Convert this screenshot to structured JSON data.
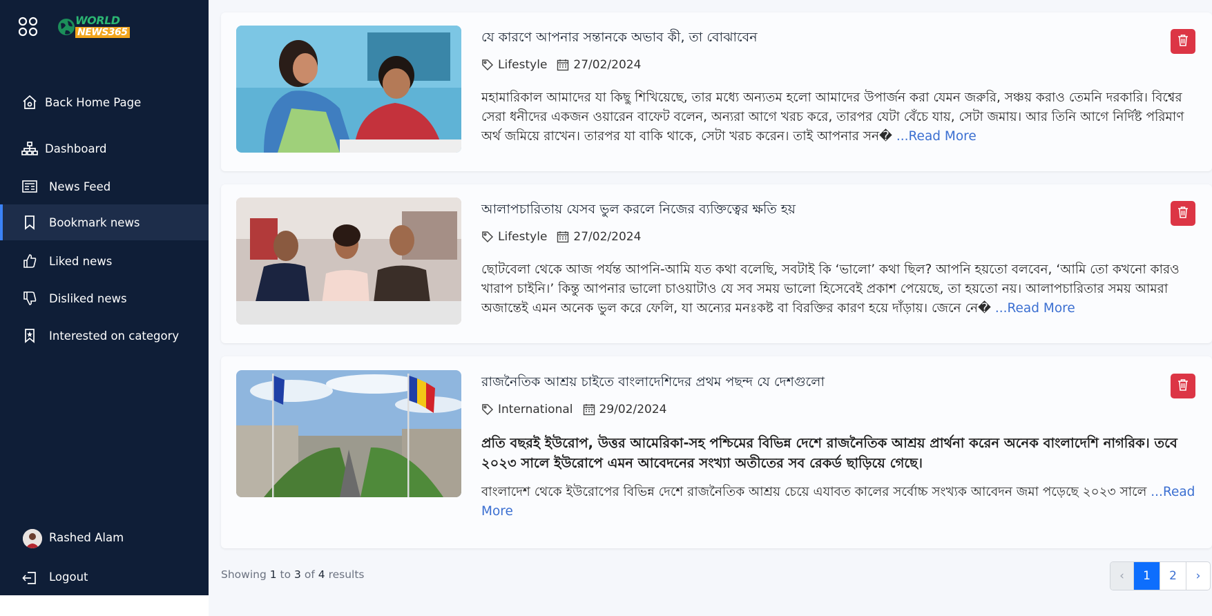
{
  "brand": {
    "logo_line1": "WORLD",
    "logo_line2": "NEWS365"
  },
  "sidebar": {
    "items": [
      {
        "label": "Back Home Page",
        "icon": "home-icon"
      },
      {
        "label": "Dashboard",
        "icon": "sitemap-icon"
      },
      {
        "label": "News Feed",
        "icon": "newspaper-icon"
      },
      {
        "label": "Bookmark news",
        "icon": "bookmark-icon",
        "active": true
      },
      {
        "label": "Liked news",
        "icon": "thumbs-up-icon"
      },
      {
        "label": "Disliked news",
        "icon": "thumbs-down-icon"
      },
      {
        "label": "Interested on category",
        "icon": "bookmark-star-icon"
      }
    ],
    "user": {
      "name": "Rashed Alam"
    },
    "logout": {
      "label": "Logout"
    }
  },
  "articles": [
    {
      "title": "যে কারণে আপনার সন্তানকে অভাব কী, তা বোঝাবেন",
      "category": "Lifestyle",
      "date": "27/02/2024",
      "excerpt": "মহামারিকাল আমাদের যা কিছু শিখিয়েছে, তার মধ্যে অন্যতম হলো আমাদের উপার্জন করা যেমন জরুরি, সঞ্চয় করাও তেমনি দরকারি। বিশ্বের সেরা ধনীদের একজন ওয়ারেন বাফেট বলেন, অন্যরা আগে খরচ করে, তারপর যেটা বেঁচে যায়, সেটা জমায়। আর তিনি আগে নির্দিষ্ট পরিমাণ অর্থ জমিয়ে রাখেন। তারপর যা বাকি থাকে, সেটা খরচ করেন। তাই আপনার সন�",
      "read_more": "...Read More"
    },
    {
      "title": "আলাপচারিতায় যেসব ভুল করলে নিজের ব্যক্তিত্বের ক্ষতি হয়",
      "category": "Lifestyle",
      "date": "27/02/2024",
      "excerpt": "ছোটবেলা থেকে আজ পর্যন্ত আপনি-আমি যত কথা বলেছি, সবটাই কি ‘ভালো’ কথা ছিল? আপনি হয়তো বলবেন, ‘আমি তো কখনো কারও খারাপ চাইনি।’ কিন্তু আপনার ভালো চাওয়াটাও যে সব সময় ভালো হিসেবেই প্রকাশ পেয়েছে, তা হয়তো নয়। আলাপচারিতার সময় আমরা অজান্তেই এমন অনেক ভুল করে ফেলি, যা অন্যের মনঃকষ্ট বা বিরক্তির কারণ হয়ে দাঁড়ায়। জেনে নে�",
      "read_more": "...Read More"
    },
    {
      "title": "রাজনৈতিক আশ্রয় চাইতে বাংলাদেশিদের প্রথম পছন্দ যে দেশগুলো",
      "category": "International",
      "date": "29/02/2024",
      "lead": "প্রতি বছরই ইউরোপ, উত্তর আমেরিকা-সহ পশ্চিমের বিভিন্ন দেশে রাজনৈতিক আশ্রয় প্রার্থনা করেন অনেক বাংলাদেশি নাগরিক। তবে ২০২৩ সালে ইউরোপে এমন আবেদনের সংখ্যা অতীতের সব রেকর্ড ছাড়িয়ে গেছে।",
      "excerpt": "বাংলাদেশ থেকে ইউরোপের বিভিন্ন দেশে রাজনৈতিক আশ্রয় চেয়ে এযাবত কালের সর্বোচ্চ সংখ্যক আবেদন জমা পড়েছে ২০২৩ সালে",
      "read_more": "...Read More"
    }
  ],
  "pagination": {
    "showing_prefix": "Showing",
    "from": "1",
    "to_word": "to",
    "to": "3",
    "of_word": "of",
    "total": "4",
    "results_word": "results",
    "prev": "‹",
    "pages": [
      "1",
      "2"
    ],
    "current": "1",
    "next": "›"
  },
  "colors": {
    "sidebar_bg": "#0f1e37",
    "delete": "#dc3545",
    "link": "#3b6fd1",
    "page_active": "#0d6efd"
  }
}
